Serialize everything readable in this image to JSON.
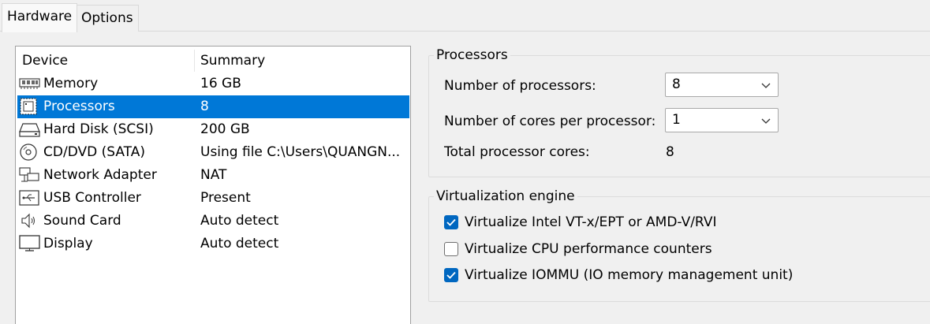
{
  "tabs": [
    {
      "label": "Hardware",
      "active": true
    },
    {
      "label": "Options",
      "active": false
    }
  ],
  "device_list": {
    "columns": [
      "Device",
      "Summary"
    ],
    "rows": [
      {
        "name": "Memory",
        "summary": "16 GB",
        "icon": "memory-icon",
        "selected": false
      },
      {
        "name": "Processors",
        "summary": "8",
        "icon": "processor-icon",
        "selected": true
      },
      {
        "name": "Hard Disk (SCSI)",
        "summary": "200 GB",
        "icon": "hard-disk-icon",
        "selected": false
      },
      {
        "name": "CD/DVD (SATA)",
        "summary": "Using file C:\\Users\\QUANGN...",
        "icon": "cd-dvd-icon",
        "selected": false
      },
      {
        "name": "Network Adapter",
        "summary": "NAT",
        "icon": "network-adapter-icon",
        "selected": false
      },
      {
        "name": "USB Controller",
        "summary": "Present",
        "icon": "usb-controller-icon",
        "selected": false
      },
      {
        "name": "Sound Card",
        "summary": "Auto detect",
        "icon": "speaker-icon",
        "selected": false
      },
      {
        "name": "Display",
        "summary": "Auto detect",
        "icon": "monitor-icon",
        "selected": false
      }
    ]
  },
  "processors": {
    "title": "Processors",
    "num_processors_label": "Number of processors:",
    "num_processors_value": "8",
    "cores_label": "Number of cores per processor:",
    "cores_value": "1",
    "total_label": "Total processor cores:",
    "total_value": "8"
  },
  "virtualization": {
    "title": "Virtualization engine",
    "options": [
      {
        "label": "Virtualize Intel VT-x/EPT or AMD-V/RVI",
        "checked": true
      },
      {
        "label": "Virtualize CPU performance counters",
        "checked": false
      },
      {
        "label": "Virtualize IOMMU (IO memory management unit)",
        "checked": true
      }
    ]
  },
  "colors": {
    "selection": "#0078d7",
    "checkbox_checked": "#0067c0"
  }
}
